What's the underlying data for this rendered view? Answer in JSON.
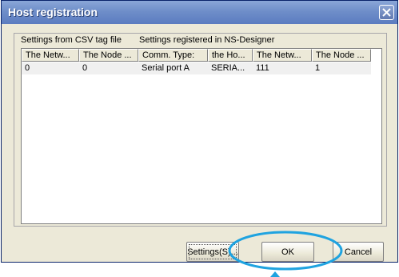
{
  "window": {
    "title": "Host registration",
    "close_icon": "close-icon"
  },
  "captions": {
    "csv": "Settings from CSV tag file",
    "ns": "Settings registered in NS-Designer"
  },
  "table": {
    "headers": [
      "The Netw...",
      "The Node ...",
      "Comm. Type:",
      "the Ho...",
      "The Netw...",
      "The Node ..."
    ],
    "rows": [
      [
        "0",
        "0",
        "Serial port A",
        "SERIA...",
        "111",
        "1"
      ]
    ]
  },
  "buttons": {
    "settings": "Settings(S)...",
    "ok": "OK",
    "cancel": "Cancel"
  },
  "colors": {
    "titlebar": "#6f8ec9",
    "annotation": "#1fa3e0"
  }
}
